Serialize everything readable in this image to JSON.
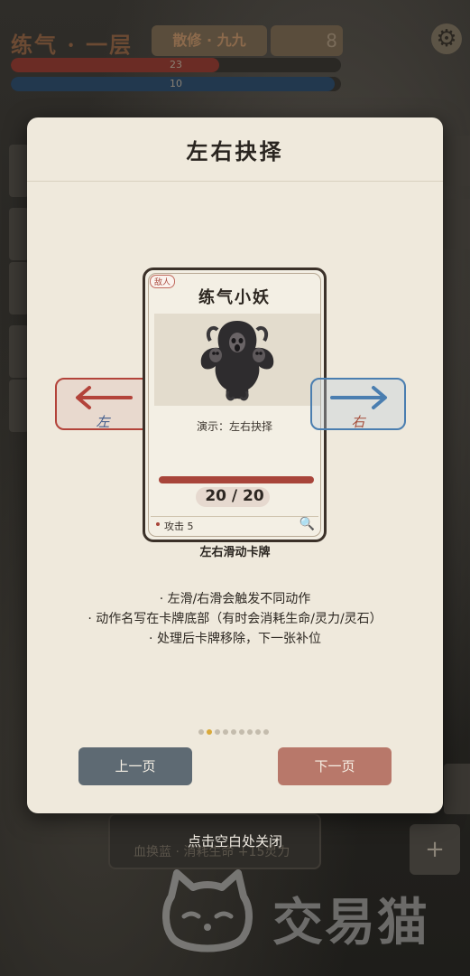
{
  "background": {
    "realm": "练气 · 一层",
    "cultivation": "散修 · 九九",
    "currency_value": "8",
    "hp_value": "23",
    "hp_fraction": 0.63,
    "mp_value": "10",
    "mp_fraction": 0.98,
    "settings_icon": "gear-icon",
    "bottom_card_text": "血换蓝 · 消耗生命 +15灵力",
    "plus_label": "+"
  },
  "modal": {
    "title": "左右抉择",
    "card": {
      "tag": "敌人",
      "name": "练气小妖",
      "demo_label": "演示：左右抉择",
      "hp_text": "20 / 20",
      "attack": "攻击 5"
    },
    "left_hint": "左",
    "right_hint": "右",
    "card_caption": "左右滑动卡牌",
    "instructions": [
      "· 左滑/右滑会触发不同动作",
      "· 动作名写在卡牌底部（有时会消耗生命/灵力/灵石）",
      "· 处理后卡牌移除，下一张补位"
    ],
    "page_count": 9,
    "current_page": 2,
    "prev_label": "上一页",
    "next_label": "下一页"
  },
  "close_hint": "点击空白处关闭",
  "watermark": "交易猫",
  "colors": {
    "modal_bg": "#efe9dc",
    "left_accent": "#b3433a",
    "right_accent": "#4a7eb0",
    "prev_button": "#5e6a73",
    "next_button": "#b8786a",
    "active_dot": "#d9a93a"
  }
}
